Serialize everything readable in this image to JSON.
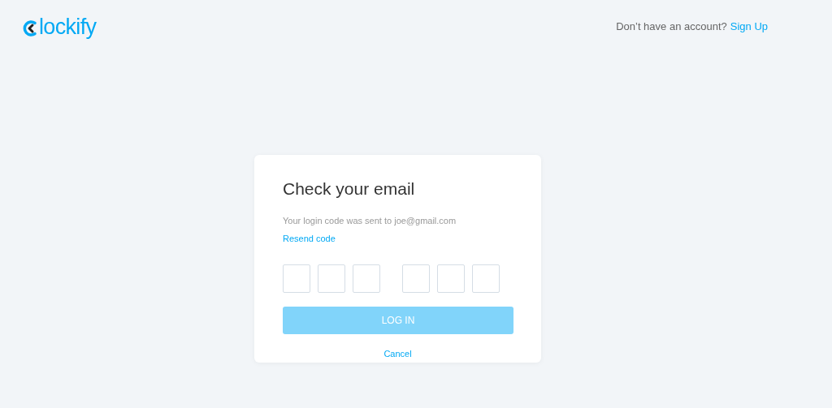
{
  "header": {
    "logo_text": "lockify",
    "prompt": "Don’t have an account?",
    "link": "Sign Up"
  },
  "card": {
    "title": "Check your email",
    "message": "Your login code was sent to joe@gmail.com",
    "resend": "Resend code",
    "code_groups": [
      [
        {
          "kind": "digit"
        },
        {
          "kind": "digit"
        },
        {
          "kind": "digit"
        }
      ],
      [
        {
          "kind": "digit"
        },
        {
          "kind": "digit"
        },
        {
          "kind": "digit"
        }
      ]
    ],
    "login_button": {
      "label": "LOG IN",
      "disabled": true
    },
    "cancel": "Cancel"
  }
}
